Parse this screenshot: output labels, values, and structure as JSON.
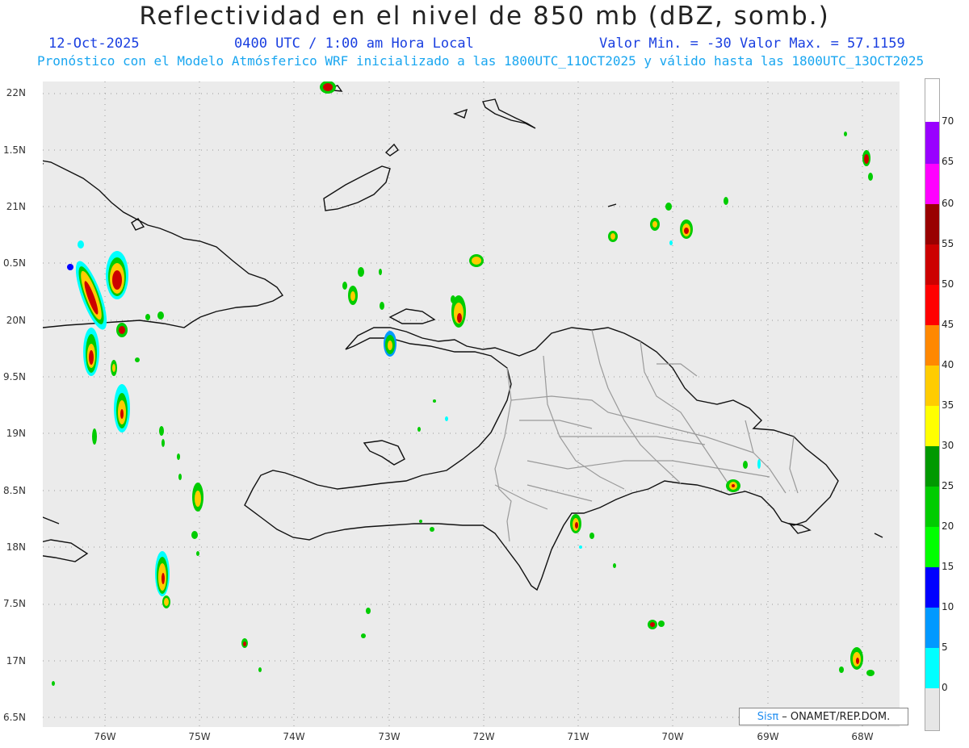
{
  "title": "Reflectividad en el nivel de 850 mb (dBZ, somb.)",
  "header": {
    "date": "12-Oct-2025",
    "time": "0400 UTC / 1:00 am Hora Local",
    "minmax": "Valor Min. = -30  Valor Max. = 57.1159",
    "forecast": "Pronóstico con el Modelo Atmósferico WRF inicializado a las 1800UTC_11OCT2025 y válido hasta las  1800UTC_13OCT2025"
  },
  "map": {
    "lon_range": [
      -76.6,
      -67.6
    ],
    "lat_range": [
      6.4,
      22.1
    ],
    "y_ticks": [
      "22N",
      "1.5N",
      "21N",
      "0.5N",
      "20N",
      "9.5N",
      "19N",
      "8.5N",
      "18N",
      "7.5N",
      "17N",
      "6.5N"
    ],
    "x_ticks": [
      "76W",
      "75W",
      "74W",
      "73W",
      "72W",
      "71W",
      "70W",
      "69W",
      "68W"
    ]
  },
  "colorbar": {
    "labels": [
      "0",
      "5",
      "10",
      "15",
      "20",
      "25",
      "30",
      "35",
      "40",
      "45",
      "50",
      "55",
      "60",
      "65",
      "70"
    ],
    "colors": [
      "#00ffff",
      "#0099ff",
      "#0000ff",
      "#00ff00",
      "#00cc00",
      "#009900",
      "#ffff00",
      "#ffcc00",
      "#ff8800",
      "#ff0000",
      "#cc0000",
      "#990000",
      "#ff00ff",
      "#9900ff"
    ]
  },
  "credit": {
    "sis": "Sisπ",
    "text": "– ONAMET/REP.DOM."
  }
}
